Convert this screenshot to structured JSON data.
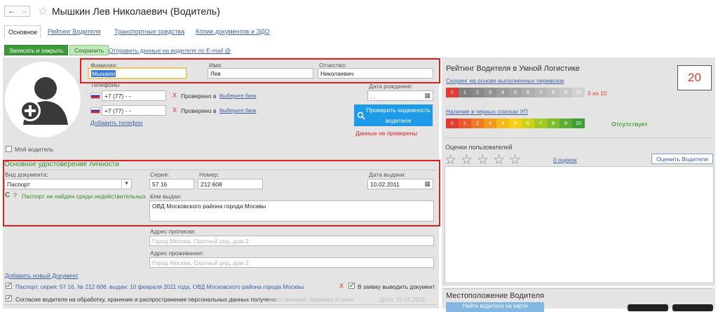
{
  "header": {
    "title": "Мышкин Лев Николаевич (Водитель)",
    "back": "←",
    "forward": "→",
    "star": "☆"
  },
  "tabs": [
    "Основное",
    "Рейтинг Водителя",
    "Транспортные средства",
    "Копии документов и ЭДО"
  ],
  "toolbar": {
    "save_close": "Записать и закрыть",
    "save": "Сохранить",
    "send_email": "Отправить данные на водителя по E-mail @"
  },
  "person": {
    "lastname_label": "Фамилия:",
    "lastname": "Мышкин",
    "firstname_label": "Имя:",
    "firstname": "Лев",
    "patronymic_label": "Отчество:",
    "patronymic": "Николаевич",
    "phones_label": "Телефоны",
    "phone1": "+7 (77)   -   -",
    "phone2": "+7 (77)   -   -",
    "verified_label": "Проверено в",
    "choose_bank": "Выберите банк",
    "x_mark": "X",
    "add_phone": "Добавить телефон",
    "birth_label": "Дата рождения:",
    "birth_value": ". .",
    "check_btn_line1": "Проверить надежность",
    "check_btn_line2": "водителя",
    "not_checked": "Данные не проверены",
    "my_driver": "Мой водитель",
    "calendar": "▦"
  },
  "identity": {
    "section_title": "Основное удостоверение личности",
    "doc_type_label": "Вид документа:",
    "doc_type": "Паспорт",
    "series_label": "Серия:",
    "series": "57 16",
    "number_label": "Номер:",
    "number": "212 608",
    "issue_date_label": "Дата выдачи:",
    "issue_date": "10.02.2011",
    "status": "Паспорт не найден среди недействительных ...",
    "refresh": "C",
    "question": "?",
    "issued_by_label": "Кем выдан:",
    "issued_by": "ОВД Московского района города Москвы",
    "reg_address_label": "Адрес прописки:",
    "reg_address_placeholder": "Город Москва, Охотный ряд, дом 2",
    "live_address_label": "Адрес проживания:",
    "live_address_placeholder": "Город Москва, Охотный ряд, дом 2",
    "add_document": "Добавить новый Документ",
    "dropdown": "▾"
  },
  "bottom": {
    "passport_line": "Паспорт, серия: 57 16, № 212 608, выдан: 10 февраля 2011 года, ОВД Московского района города Москвы",
    "in_request": "В заявку выводить документ",
    "x_mark": "X",
    "consent": "Согласие водителя на обработку, хранение и распространение персональных данных получено.",
    "responsible": "Ответственный: Ширяева Ксения",
    "date": "Дата: 21.05.2021"
  },
  "rating": {
    "title": "Рейтинг Водителя в Умной Логистике",
    "score": "20",
    "scoring_link": "Скоринг на основе выполненных перевозок",
    "scale": [
      "0",
      "1",
      "2",
      "3",
      "4",
      "5",
      "6",
      "7",
      "8",
      "9",
      "10"
    ],
    "scoring_result": "0 из 10",
    "blacklist_link": "Наличие в черных списках УП",
    "blacklist_result": "Отсутствует",
    "user_ratings_label": "Оценки пользователей",
    "ratings_count": "0 оценок",
    "rate_btn": "Оценить Водителя",
    "star": "☆"
  },
  "location": {
    "title": "Местоположение Водителя",
    "find_btn": "Найти водителя на карте"
  },
  "colors": {
    "accent_red": "#e02020",
    "green": "#3a8a2a",
    "blue_btn": "#1e9be8"
  }
}
